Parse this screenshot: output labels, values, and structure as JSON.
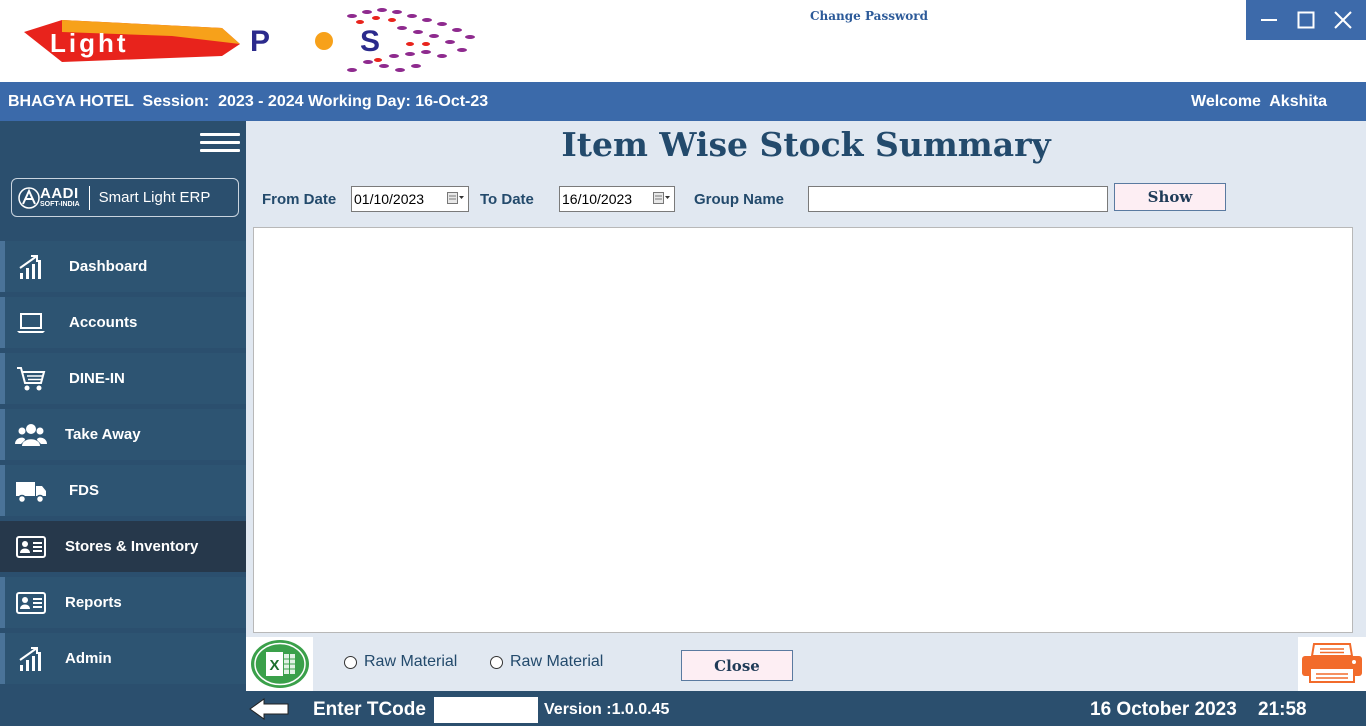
{
  "header": {
    "logo_text": "Light POS",
    "change_password": "Change Password"
  },
  "session_bar": {
    "info": "BHAGYA HOTEL  Session:  2023 - 2024 Working Day: 16-Oct-23",
    "welcome": "Welcome  Akshita"
  },
  "sidebar": {
    "brand": {
      "mark": "AADI",
      "sub": "SOFT-INDIA",
      "name": "Smart Light ERP"
    },
    "items": [
      {
        "label": "Dashboard",
        "icon": "bar-chart-icon"
      },
      {
        "label": "Accounts",
        "icon": "laptop-icon"
      },
      {
        "label": "DINE-IN",
        "icon": "cart-icon"
      },
      {
        "label": "Take Away",
        "icon": "users-icon"
      },
      {
        "label": "FDS",
        "icon": "truck-icon"
      },
      {
        "label": "Stores & Inventory",
        "icon": "id-card-icon",
        "active": true
      },
      {
        "label": "Reports",
        "icon": "id-card-icon"
      },
      {
        "label": "Admin",
        "icon": "bar-chart-icon"
      }
    ]
  },
  "main": {
    "title": "Item Wise Stock Summary",
    "filters": {
      "from_label": "From Date",
      "from_value": "01/10/2023",
      "to_label": "To Date",
      "to_value": "16/10/2023",
      "group_label": "Group Name",
      "group_value": "",
      "show_label": "Show"
    },
    "options": [
      {
        "label": "Raw Material",
        "checked": false
      },
      {
        "label": "Raw Material",
        "checked": false
      }
    ],
    "close_label": "Close"
  },
  "footer": {
    "tcode_label": "Enter TCode",
    "tcode_value": "",
    "version": "Version :1.0.0.45",
    "date": "16 October 2023",
    "time": "21:58"
  },
  "colors": {
    "session_bar": "#3b6aaa",
    "sidebar": "#2b4f6e",
    "active_item": "#26384b",
    "content_bg": "#e1e8f1",
    "title": "#234a6c",
    "button_bg": "#fdeef3"
  }
}
